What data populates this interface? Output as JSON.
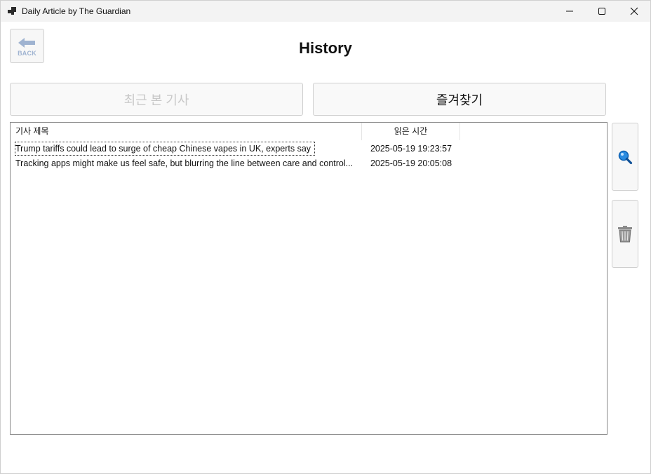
{
  "window": {
    "title": "Daily Article by The Guardian",
    "controls": [
      "minimize-icon",
      "maximize-icon",
      "close-icon"
    ]
  },
  "back_button": {
    "label": "BACK",
    "icon": "back-arrow-icon"
  },
  "page": {
    "title": "History"
  },
  "tabs": [
    {
      "label": "최근 본 기사",
      "enabled": false
    },
    {
      "label": "즐겨찾기",
      "enabled": true
    }
  ],
  "list": {
    "columns": [
      "기사 제목",
      "읽은 시간"
    ],
    "rows": [
      {
        "title": "Trump tariffs could lead to surge of cheap Chinese vapes in UK, experts say",
        "time": "2025-05-19 19:23:57",
        "focused": true
      },
      {
        "title": "Tracking apps might make us feel safe, but blurring the line between care and control...",
        "time": "2025-05-19 20:05:08",
        "focused": false
      }
    ]
  },
  "side_buttons": [
    {
      "icon": "search-icon",
      "color": "#1a73e8"
    },
    {
      "icon": "trash-icon",
      "color": "#7a7a7a"
    }
  ],
  "colors": {
    "back_accent": "#9fb3d1",
    "disabled_text": "#c8c8c8"
  }
}
